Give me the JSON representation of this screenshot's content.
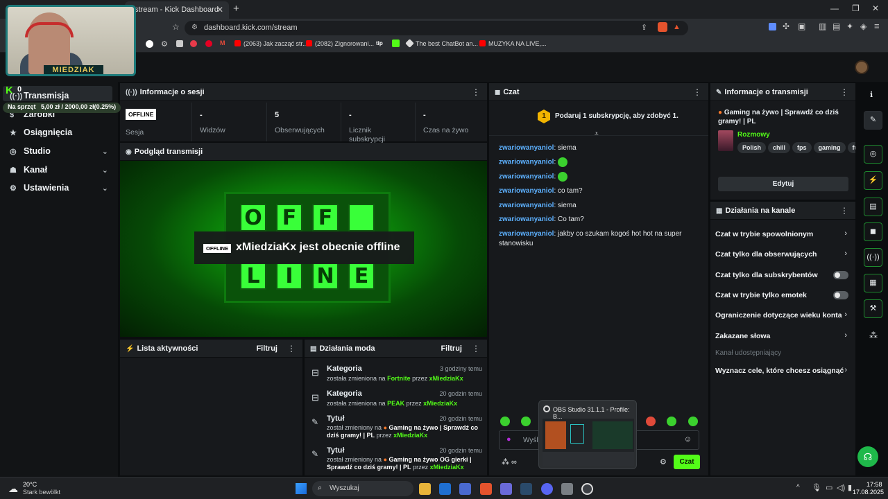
{
  "browser": {
    "tab_title": "stream - Kick Dashboard",
    "url": "dashboard.kick.com/stream",
    "bookmarks": [
      "(2063) Jak zacząć str...",
      "(2082) Zignorowani...",
      "The best ChatBot an...",
      "MUZYKA NA LIVE,..."
    ]
  },
  "webcam": {
    "name": "MIEDZIAK"
  },
  "goal": {
    "label": "Na sprzęt",
    "amount": "5,00 zł / 2000,00 zł(0.25%)"
  },
  "sidebar": {
    "items": [
      {
        "label": "Transmisja"
      },
      {
        "label": "Zarobki"
      },
      {
        "label": "Osiągnięcia"
      },
      {
        "label": "Studio"
      },
      {
        "label": "Kanał"
      },
      {
        "label": "Ustawienia"
      }
    ]
  },
  "session": {
    "title": "Informacje o sesji",
    "status": "OFFLINE",
    "stats": [
      {
        "value": "",
        "label": "Sesja"
      },
      {
        "value": "-",
        "label": "Widzów"
      },
      {
        "value": "5",
        "label": "Obserwujących"
      },
      {
        "value": "-",
        "label": "Licznik subskrypcji"
      },
      {
        "value": "-",
        "label": "Czas na żywo"
      }
    ]
  },
  "preview": {
    "title": "Podgląd transmisji",
    "offline_tag": "OFFLINE",
    "offline_text": "xMiedziaKx jest obecnie offline",
    "sign_top": [
      "O",
      "F",
      "F",
      ""
    ],
    "sign_bottom": [
      "L",
      "I",
      "N",
      "E"
    ]
  },
  "activity": {
    "title": "Lista aktywności",
    "filter": "Filtruj"
  },
  "mod": {
    "title": "Działania moda",
    "filter": "Filtruj",
    "entries": [
      {
        "type": "Kategoria",
        "time": "3 godziny temu",
        "pre": "została zmieniona na",
        "value": "Fortnite",
        "by": "przez",
        "user": "xMiedziaKx"
      },
      {
        "type": "Kategoria",
        "time": "20 godzin temu",
        "pre": "została zmieniona na",
        "value": "PEAK",
        "by": "przez",
        "user": "xMiedziaKx"
      },
      {
        "type": "Tytuł",
        "time": "20 godzin temu",
        "pre": "został zmieniony na",
        "value": "Gaming na żywo | Sprawdź co dziś gramy! | PL",
        "by": "przez",
        "user": "xMiedziaKx"
      },
      {
        "type": "Tytuł",
        "time": "20 godzin temu",
        "pre": "został zmieniony na",
        "value": "Gaming na żywo OG gierki | Sprawdź co dziś gramy! | PL",
        "by": "przez",
        "user": "xMiedziaKx"
      }
    ]
  },
  "chat": {
    "title": "Czat",
    "sub_banner": "Podaruj 1 subskrypcję, aby zdobyć 1.",
    "messages": [
      {
        "user": "zwariowanyaniol",
        "text": "siema"
      },
      {
        "user": "zwariowanyaniol",
        "text": ""
      },
      {
        "user": "zwariowanyaniol",
        "text": ""
      },
      {
        "user": "zwariowanyaniol",
        "text": "co tam?"
      },
      {
        "user": "zwariowanyaniol",
        "text": "siema"
      },
      {
        "user": "zwariowanyaniol",
        "text": "Co tam?"
      },
      {
        "user": "zwariowanyaniol",
        "text": "jakby co szukam kogoś hot hot na super stanowisku"
      }
    ],
    "input_placeholder": "Wyśl",
    "send_label": "Czat"
  },
  "stream_info": {
    "title": "Informacje o transmisji",
    "stream_title": "Gaming na żywo | Sprawdź co dziś gramy! | PL",
    "category": "Rozmowy",
    "tags": [
      "Polish",
      "chill",
      "fps",
      "gaming",
      "fun"
    ],
    "edit_label": "Edytuj"
  },
  "channel_actions": {
    "title": "Działania na kanale",
    "items": [
      {
        "label": "Czat w trybie spowolnionym",
        "control": "chevron"
      },
      {
        "label": "Czat tylko dla obserwujących",
        "control": "chevron"
      },
      {
        "label": "Czat tylko dla subskrybentów",
        "control": "toggle"
      },
      {
        "label": "Czat w trybie tylko emotek",
        "control": "toggle"
      },
      {
        "label": "Ograniczenie dotyczące wieku konta",
        "control": "chevron"
      },
      {
        "label": "Zakazane słowa",
        "control": "chevron"
      }
    ],
    "shared_label": "Kanał udostępniający",
    "goals_label": "Wyznacz cele, które chcesz osiągnąć"
  },
  "obs_popup": {
    "title": "OBS Studio 31.1.1 - Profile: B..."
  },
  "taskbar": {
    "weather_temp": "20°C",
    "weather_desc": "Stark bewölkt",
    "search_placeholder": "Wyszukaj",
    "time": "17:58",
    "date": "17.08.2025"
  },
  "colors": {
    "accent": "#53fc18",
    "chat_user": "#5db1ff",
    "bg": "#0b0d0f"
  }
}
